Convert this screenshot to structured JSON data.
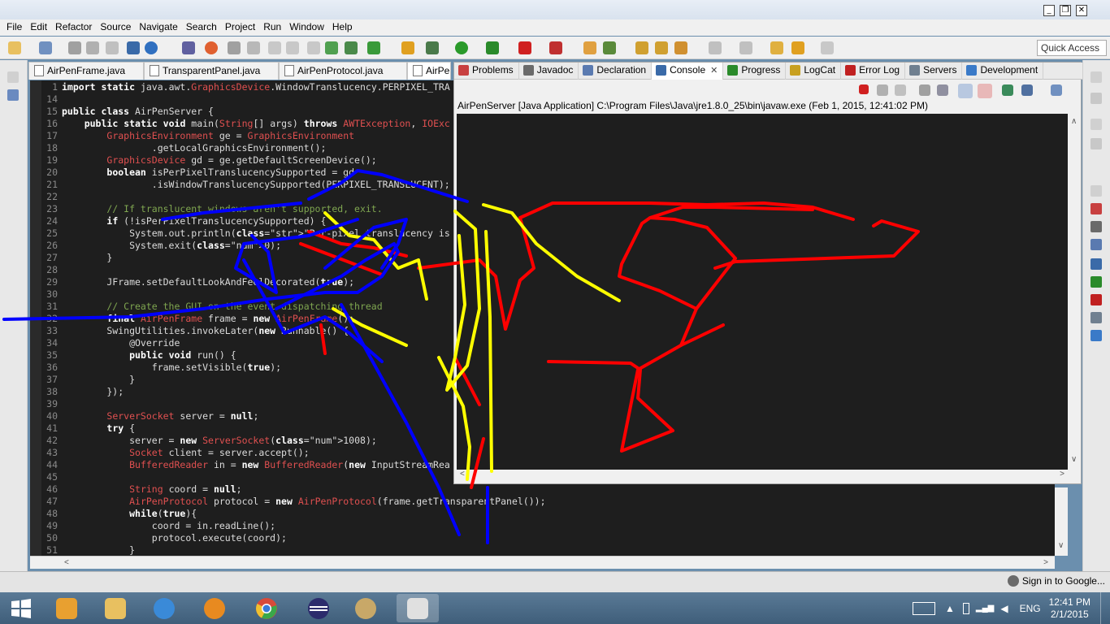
{
  "title_bar": {
    "min": "_",
    "restore": "❐",
    "close": "✕"
  },
  "menu": [
    "File",
    "Edit",
    "Refactor",
    "Source",
    "Navigate",
    "Search",
    "Project",
    "Run",
    "Window",
    "Help"
  ],
  "toolbar": {
    "quick_access": "Quick Access"
  },
  "editor_tabs": [
    {
      "label": "AirPenFrame.java"
    },
    {
      "label": "TransparentPanel.java"
    },
    {
      "label": "AirPenProtocol.java"
    },
    {
      "label": "AirPen"
    }
  ],
  "console_tabs": [
    {
      "label": "Problems",
      "icon": "problems-icon",
      "color": "#c84040"
    },
    {
      "label": "Javadoc",
      "icon": "at-icon",
      "color": "#6a6a6a"
    },
    {
      "label": "Declaration",
      "icon": "declaration-icon",
      "color": "#5a7ab0"
    },
    {
      "label": "Console",
      "icon": "console-icon",
      "color": "#3a6aa8",
      "active": true,
      "close": "✕"
    },
    {
      "label": "Progress",
      "icon": "progress-icon",
      "color": "#2a8a2a"
    },
    {
      "label": "LogCat",
      "icon": "logcat-icon",
      "color": "#c8a020"
    },
    {
      "label": "Error Log",
      "icon": "error-log-icon",
      "color": "#c02020"
    },
    {
      "label": "Servers",
      "icon": "servers-icon",
      "color": "#708090"
    },
    {
      "label": "Development",
      "icon": "development-icon",
      "color": "#3a7ac8"
    }
  ],
  "console": {
    "launch_info": "AirPenServer [Java Application] C:\\Program Files\\Java\\jre1.8.0_25\\bin\\javaw.exe (Feb 1, 2015, 12:41:02 PM)"
  },
  "code_lines": [
    {
      "n": "1",
      "text": "import static java.awt.GraphicsDevice.WindowTranslucency.PERPIXEL_TRA"
    },
    {
      "n": "14",
      "text": ""
    },
    {
      "n": "15",
      "text": "public class AirPenServer {"
    },
    {
      "n": "16",
      "text": "    public static void main(String[] args) throws AWTException, IOExc"
    },
    {
      "n": "17",
      "text": "        GraphicsEnvironment ge = GraphicsEnvironment"
    },
    {
      "n": "18",
      "text": "                .getLocalGraphicsEnvironment();"
    },
    {
      "n": "19",
      "text": "        GraphicsDevice gd = ge.getDefaultScreenDevice();"
    },
    {
      "n": "20",
      "text": "        boolean isPerPixelTranslucencySupported = gd"
    },
    {
      "n": "21",
      "text": "                .isWindowTranslucencySupported(PERPIXEL_TRANSLUCENT);"
    },
    {
      "n": "22",
      "text": ""
    },
    {
      "n": "23",
      "text": "        // If translucent windows aren't supported, exit."
    },
    {
      "n": "24",
      "text": "        if (!isPerPixelTranslucencySupported) {"
    },
    {
      "n": "25",
      "text": "            System.out.println(\"Per-pixel translucency is not support"
    },
    {
      "n": "26",
      "text": "            System.exit(0);"
    },
    {
      "n": "27",
      "text": "        }"
    },
    {
      "n": "28",
      "text": ""
    },
    {
      "n": "29",
      "text": "        JFrame.setDefaultLookAndFeelDecorated(true);"
    },
    {
      "n": "30",
      "text": ""
    },
    {
      "n": "31",
      "text": "        // Create the GUI on the event-dispatching thread"
    },
    {
      "n": "32",
      "text": "        final AirPenFrame frame = new AirPenFrame();"
    },
    {
      "n": "33",
      "text": "        SwingUtilities.invokeLater(new Runnable() {"
    },
    {
      "n": "34",
      "text": "            @Override"
    },
    {
      "n": "35",
      "text": "            public void run() {"
    },
    {
      "n": "36",
      "text": "                frame.setVisible(true);"
    },
    {
      "n": "37",
      "text": "            }"
    },
    {
      "n": "38",
      "text": "        });"
    },
    {
      "n": "39",
      "text": ""
    },
    {
      "n": "40",
      "text": "        ServerSocket server = null;"
    },
    {
      "n": "41",
      "text": "        try {"
    },
    {
      "n": "42",
      "text": "            server = new ServerSocket(1008);"
    },
    {
      "n": "43",
      "text": "            Socket client = server.accept();"
    },
    {
      "n": "44",
      "text": "            BufferedReader in = new BufferedReader(new InputStreamRea"
    },
    {
      "n": "45",
      "text": ""
    },
    {
      "n": "46",
      "text": "            String coord = null;"
    },
    {
      "n": "47",
      "text": "            AirPenProtocol protocol = new AirPenProtocol(frame.getTransparentPanel());"
    },
    {
      "n": "48",
      "text": "            while(true){"
    },
    {
      "n": "49",
      "text": "                coord = in.readLine();"
    },
    {
      "n": "50",
      "text": "                protocol.execute(coord);"
    },
    {
      "n": "51",
      "text": "            }"
    }
  ],
  "status_bar": {
    "signin": "Sign in to Google..."
  },
  "taskbar": {
    "apps": [
      {
        "name": "start-button",
        "color": "#ffffff"
      },
      {
        "name": "metro-apps",
        "color": "#e8a030"
      },
      {
        "name": "file-explorer",
        "color": "#e8c060"
      },
      {
        "name": "media-player",
        "color": "#3a8ad8"
      },
      {
        "name": "media-center",
        "color": "#e88a20"
      },
      {
        "name": "chrome",
        "color": "#d84a3a"
      },
      {
        "name": "eclipse",
        "color": "#2c2c6c"
      },
      {
        "name": "paint",
        "color": "#c8a868"
      },
      {
        "name": "java",
        "color": "#e0e0e0"
      }
    ],
    "language": "ENG",
    "time": "12:41 PM",
    "date": "2/1/2015"
  },
  "drawing_colors": {
    "red": "#ff0000",
    "blue": "#0000ff",
    "yellow": "#ffff00"
  }
}
